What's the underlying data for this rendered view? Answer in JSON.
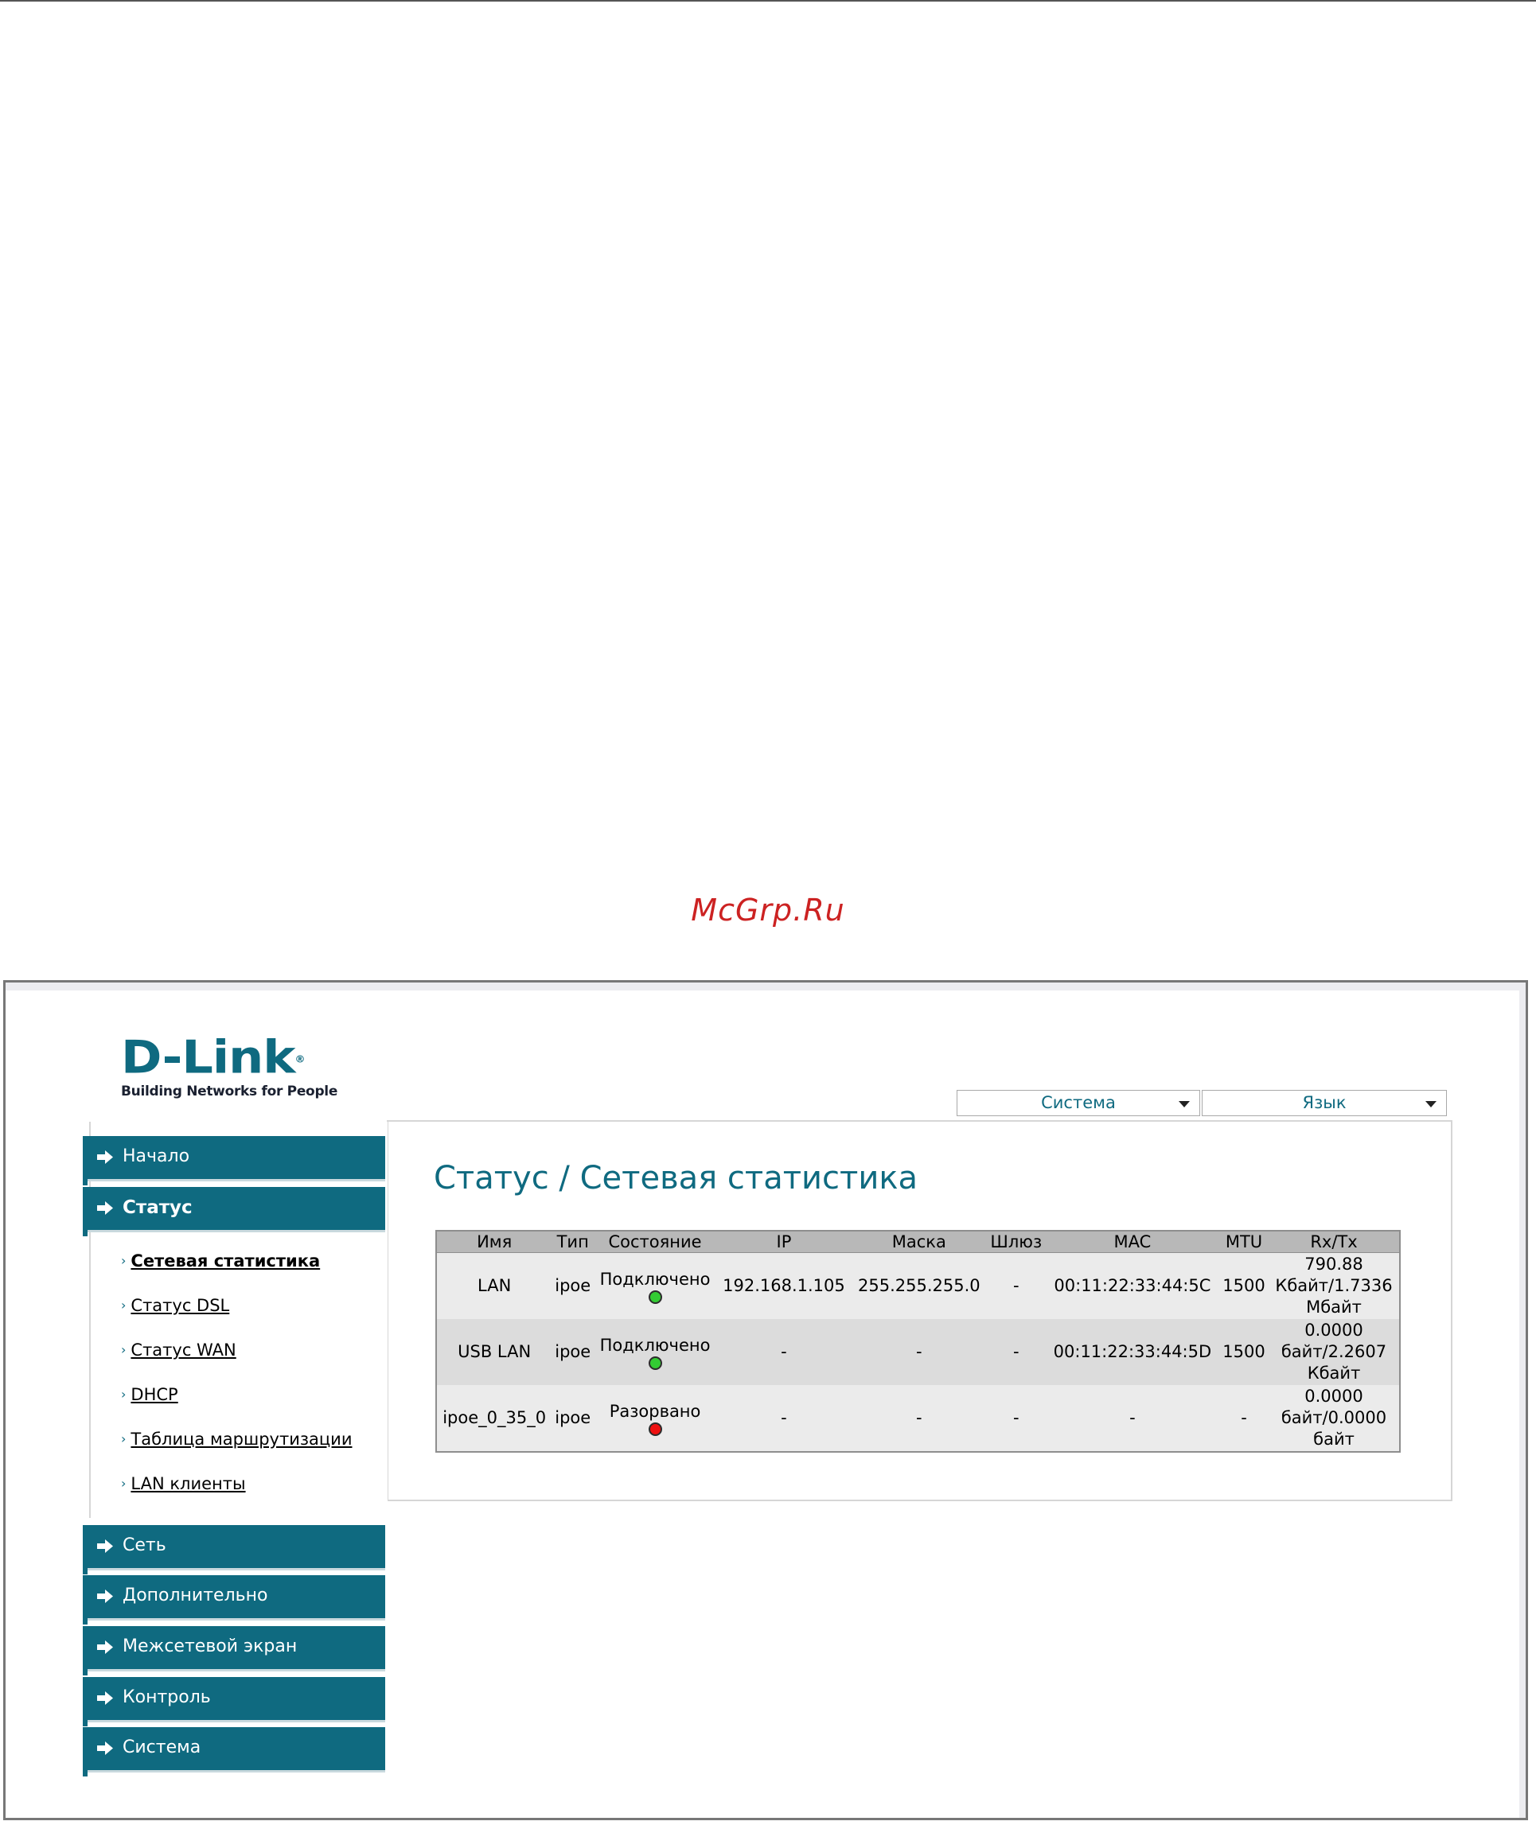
{
  "watermark": "McGrp.Ru",
  "logo": {
    "name": "D-Link",
    "registered": "®",
    "tagline": "Building Networks for People"
  },
  "top_menus": [
    {
      "label": "Система"
    },
    {
      "label": "Язык"
    }
  ],
  "page_title": "Статус /  Сетевая статистика",
  "nav": {
    "items": [
      {
        "label": "Начало",
        "active": false
      },
      {
        "label": "Статус",
        "active": true
      },
      {
        "label": "Сеть",
        "active": false
      },
      {
        "label": "Дополнительно",
        "active": false
      },
      {
        "label": "Межсетевой экран",
        "active": false
      },
      {
        "label": "Контроль",
        "active": false
      },
      {
        "label": "Система",
        "active": false
      }
    ],
    "status_subitems": [
      {
        "label": "Сетевая статистика",
        "current": true
      },
      {
        "label": "Статус DSL",
        "current": false
      },
      {
        "label": "Статус WAN",
        "current": false
      },
      {
        "label": "DHCP",
        "current": false
      },
      {
        "label": "Таблица маршрутизации",
        "current": false
      },
      {
        "label": "LAN клиенты",
        "current": false
      }
    ]
  },
  "table": {
    "headers": [
      "Имя",
      "Тип",
      "Состояние",
      "IP",
      "Маска",
      "Шлюз",
      "MAC",
      "MTU",
      "Rx/Tx"
    ],
    "rows": [
      {
        "name": "LAN",
        "type": "ipoe",
        "state": "Подключено",
        "state_color": "#33cc33",
        "ip": "192.168.1.105",
        "mask": "255.255.255.0",
        "gateway": "-",
        "mac": "00:11:22:33:44:5C",
        "mtu": "1500",
        "rxtx": "790.88 Кбайт/1.7336 Мбайт"
      },
      {
        "name": "USB LAN",
        "type": "ipoe",
        "state": "Подключено",
        "state_color": "#33cc33",
        "ip": "-",
        "mask": "-",
        "gateway": "-",
        "mac": "00:11:22:33:44:5D",
        "mtu": "1500",
        "rxtx": "0.0000 байт/2.2607 Кбайт"
      },
      {
        "name": "ipoe_0_35_0",
        "type": "ipoe",
        "state": "Разорвано",
        "state_color": "#ee1111",
        "ip": "-",
        "mask": "-",
        "gateway": "-",
        "mac": "-",
        "mtu": "-",
        "rxtx": "0.0000 байт/0.0000 байт"
      }
    ]
  },
  "colors": {
    "brand": "#0f6a80",
    "connected": "#33cc33",
    "disconnected": "#ee1111"
  }
}
